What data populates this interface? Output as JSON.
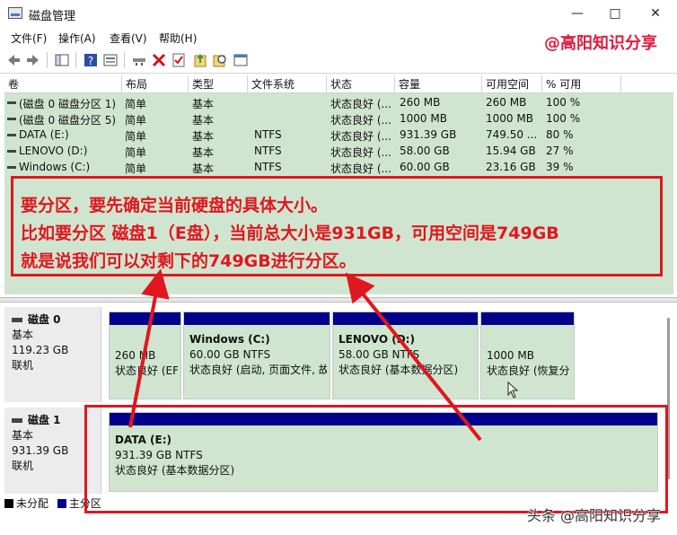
{
  "window": {
    "title": "磁盘管理",
    "icon": "disk-management-icon",
    "controls": [
      "minimize-icon",
      "maximize-icon",
      "close-icon"
    ]
  },
  "menu": [
    "文件(F)",
    "操作(A)",
    "查看(V)",
    "帮助(H)"
  ],
  "watermark_top": "@高阳知识分享",
  "toolbar": [
    "back-icon",
    "forward-icon",
    "console-tree-icon",
    "help-icon",
    "properties-icon",
    "connect-icon",
    "delete-icon",
    "check-icon",
    "import-icon",
    "search-icon",
    "window-icon"
  ],
  "volume_table": {
    "columns": [
      "卷",
      "布局",
      "类型",
      "文件系统",
      "状态",
      "容量",
      "可用空间",
      "% 可用"
    ],
    "rows": [
      [
        "(磁盘 0 磁盘分区 1)",
        "简单",
        "基本",
        "",
        "状态良好 (...",
        "260 MB",
        "260 MB",
        "100 %"
      ],
      [
        "(磁盘 0 磁盘分区 5)",
        "简单",
        "基本",
        "",
        "状态良好 (...",
        "1000 MB",
        "1000 MB",
        "100 %"
      ],
      [
        "DATA (E:)",
        "简单",
        "基本",
        "NTFS",
        "状态良好 (...",
        "931.39 GB",
        "749.50 ...",
        "80 %"
      ],
      [
        "LENOVO (D:)",
        "简单",
        "基本",
        "NTFS",
        "状态良好 (...",
        "58.00 GB",
        "15.94 GB",
        "27 %"
      ],
      [
        "Windows (C:)",
        "简单",
        "基本",
        "NTFS",
        "状态良好 (...",
        "60.00 GB",
        "23.16 GB",
        "39 %"
      ]
    ]
  },
  "annotation": {
    "lines": [
      "要分区，要先确定当前硬盘的具体大小。",
      "比如要分区 磁盘1（E盘），当前总大小是931GB，可用空间是749GB",
      "就是说我们可以对剩下的749GB进行分区。"
    ],
    "color": "#e0171f"
  },
  "disks": [
    {
      "name": "磁盘 0",
      "type": "基本",
      "size": "119.23 GB",
      "status": "联机",
      "partitions": [
        {
          "name": "",
          "line1": "260 MB",
          "line2": "状态良好 (EF"
        },
        {
          "name": "Windows  (C:)",
          "line1": "60.00 GB NTFS",
          "line2": "状态良好 (启动, 页面文件, 故"
        },
        {
          "name": "LENOVO  (D:)",
          "line1": "58.00 GB NTFS",
          "line2": "状态良好 (基本数据分区)"
        },
        {
          "name": "",
          "line1": "1000 MB",
          "line2": "状态良好 (恢复分"
        }
      ]
    },
    {
      "name": "磁盘 1",
      "type": "基本",
      "size": "931.39 GB",
      "status": "联机",
      "partitions": [
        {
          "name": "DATA  (E:)",
          "line1": "931.39 GB NTFS",
          "line2": "状态良好 (基本数据分区)"
        }
      ]
    }
  ],
  "legend": [
    {
      "label": "未分配",
      "color": "#000000"
    },
    {
      "label": "主分区",
      "color": "#00008b"
    }
  ],
  "watermark_bottom": "头条 @高阳知识分享",
  "colors": {
    "partition_fill": "#cfe5cf",
    "partition_bar": "#00008b"
  }
}
